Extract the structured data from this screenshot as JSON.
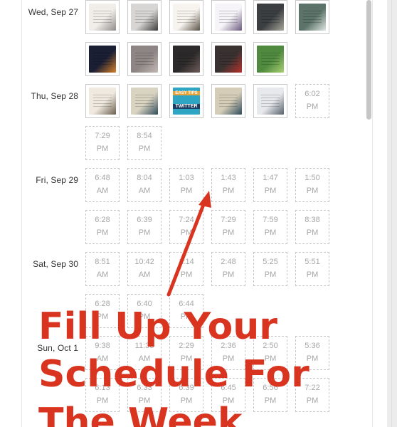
{
  "schedule": {
    "days": [
      {
        "label": "Wed, Sep 27",
        "thumbs_row1": [
          {
            "name": "post-thumb-wed-1",
            "color": "#f1eeea",
            "accent": "#8e8b88"
          },
          {
            "name": "post-thumb-wed-2",
            "color": "#d8d6d4",
            "accent": "#3b3b3b"
          },
          {
            "name": "post-thumb-wed-3",
            "color": "#f7f3ee",
            "accent": "#5a5146"
          },
          {
            "name": "post-thumb-wed-4",
            "color": "#f6f4f8",
            "accent": "#6a5a7d"
          },
          {
            "name": "post-thumb-wed-5",
            "color": "#3c3f42",
            "accent": "#a8a69a"
          },
          {
            "name": "post-thumb-wed-6",
            "color": "#5b7368",
            "accent": "#dfe6e2"
          }
        ],
        "thumbs_row2": [
          {
            "name": "post-thumb-wed-7",
            "color": "#1b1f34",
            "accent": "#d9822b"
          },
          {
            "name": "post-thumb-wed-8",
            "color": "#8e8684",
            "accent": "#c2b8b5"
          },
          {
            "name": "post-thumb-wed-9",
            "color": "#2c2a2a",
            "accent": "#6f5c59"
          },
          {
            "name": "post-thumb-wed-10",
            "color": "#3a3231",
            "accent": "#b7322c"
          },
          {
            "name": "post-thumb-wed-11",
            "color": "#4f8a3f",
            "accent": "#a9cf72"
          }
        ]
      },
      {
        "label": "Thu, Sep 28",
        "thumbs_row1": [
          {
            "name": "post-thumb-thu-1",
            "color": "#efe9df",
            "accent": "#6c5e4d"
          },
          {
            "name": "post-thumb-thu-2",
            "color": "#d9d3c1",
            "accent": "#2d4a59"
          },
          {
            "name": "post-thumb-thu-3",
            "color": "#30a9c7",
            "accent": "#1f3f66"
          },
          {
            "name": "post-thumb-thu-4",
            "color": "#d5cdb8",
            "accent": "#2d4a59"
          },
          {
            "name": "post-thumb-thu-5",
            "color": "#e7e9ec",
            "accent": "#57606b"
          }
        ],
        "slots_row1_tail": [
          {
            "time": "6:02",
            "meridiem": "PM"
          }
        ],
        "slots_row2": [
          {
            "time": "7:29",
            "meridiem": "PM"
          },
          {
            "time": "8:54",
            "meridiem": "PM"
          }
        ],
        "thumb_labels": {
          "thu_3_top": "EASY TIPS",
          "thu_3_bottom": "TWITTER"
        }
      },
      {
        "label": "Fri, Sep 29",
        "slots_row1": [
          {
            "time": "6:48",
            "meridiem": "AM"
          },
          {
            "time": "8:04",
            "meridiem": "AM"
          },
          {
            "time": "1:03",
            "meridiem": "PM"
          },
          {
            "time": "1:43",
            "meridiem": "PM"
          },
          {
            "time": "1:47",
            "meridiem": "PM"
          },
          {
            "time": "1:50",
            "meridiem": "PM"
          }
        ],
        "slots_row2": [
          {
            "time": "6:28",
            "meridiem": "PM"
          },
          {
            "time": "6:39",
            "meridiem": "PM"
          },
          {
            "time": "7:24",
            "meridiem": "PM"
          },
          {
            "time": "7:29",
            "meridiem": "PM"
          },
          {
            "time": "7:59",
            "meridiem": "PM"
          },
          {
            "time": "8:38",
            "meridiem": "PM"
          }
        ]
      },
      {
        "label": "Sat, Sep 30",
        "slots_row1": [
          {
            "time": "8:51",
            "meridiem": "AM"
          },
          {
            "time": "10:42",
            "meridiem": "AM"
          },
          {
            "time": "1:14",
            "meridiem": "PM"
          },
          {
            "time": "2:48",
            "meridiem": "PM"
          },
          {
            "time": "5:25",
            "meridiem": "PM"
          },
          {
            "time": "5:51",
            "meridiem": "PM"
          }
        ],
        "slots_row2": [
          {
            "time": "6:28",
            "meridiem": "PM"
          },
          {
            "time": "6:40",
            "meridiem": "PM"
          },
          {
            "time": "6:44",
            "meridiem": "PM"
          }
        ]
      },
      {
        "label": "Sun, Oct 1",
        "slots_row1": [
          {
            "time": "9:38",
            "meridiem": "AM"
          },
          {
            "time": "11:33",
            "meridiem": "AM"
          },
          {
            "time": "2:29",
            "meridiem": "PM"
          },
          {
            "time": "2:36",
            "meridiem": "PM"
          },
          {
            "time": "2:50",
            "meridiem": "PM"
          },
          {
            "time": "5:36",
            "meridiem": "PM"
          }
        ],
        "slots_row2": [
          {
            "time": "6:13",
            "meridiem": "PM"
          },
          {
            "time": "6:33",
            "meridiem": "PM"
          },
          {
            "time": "6:39",
            "meridiem": "PM"
          },
          {
            "time": "6:45",
            "meridiem": "PM"
          },
          {
            "time": "6:56",
            "meridiem": "PM"
          },
          {
            "time": "7:22",
            "meridiem": "PM"
          }
        ]
      }
    ]
  },
  "annotation": {
    "line1": "Fill Up Your",
    "line2": "Schedule For",
    "line3": "The Week",
    "color": "#d9341f"
  },
  "theme": {
    "slot_border": "#c7c7c7",
    "slot_text": "#a6a6a6",
    "label_text": "#333333"
  }
}
